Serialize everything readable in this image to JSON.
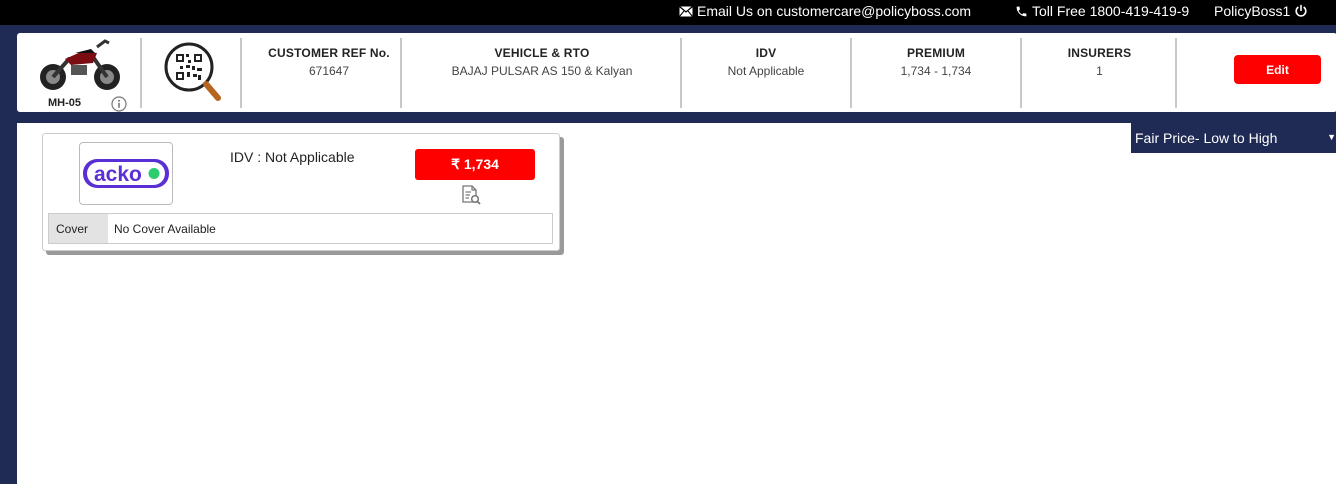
{
  "topbar": {
    "email": "Email Us on customercare@policyboss.com",
    "tollfree": "Toll Free 1800-419-419-9",
    "user": "PolicyBoss1"
  },
  "summary": {
    "plate": "MH-05",
    "customer_ref_label": "CUSTOMER REF No.",
    "customer_ref_value": "671647",
    "vehicle_label": "VEHICLE & RTO",
    "vehicle_value": "BAJAJ PULSAR AS 150 & Kalyan",
    "idv_label": "IDV",
    "idv_value": "Not Applicable",
    "premium_label": "PREMIUM",
    "premium_value": "1,734 - 1,734",
    "insurers_label": "INSURERS",
    "insurers_value": "1",
    "edit_label": "Edit"
  },
  "sort": {
    "selected": "Fair Price- Low to High"
  },
  "quote": {
    "insurer_logo_text": "acko",
    "idv_text": "IDV : Not Applicable",
    "price": "₹ 1,734",
    "cover_label": "Cover",
    "cover_value": "No Cover Available"
  },
  "colors": {
    "navy": "#1f2a55",
    "accent_red": "#ff0000",
    "acko_purple": "#5a2fd4",
    "acko_green": "#2ecc71"
  }
}
